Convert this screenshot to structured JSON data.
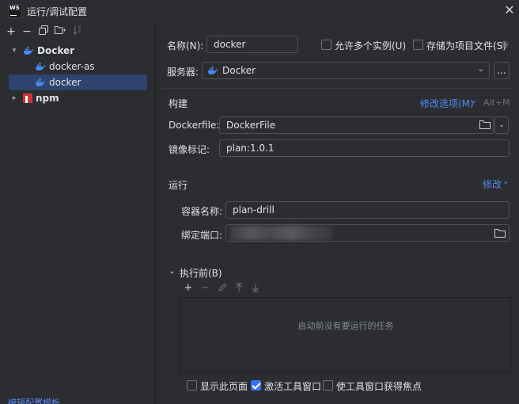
{
  "window": {
    "logo_text": "WS",
    "title": "运行/调试配置",
    "close_glyph": "✕"
  },
  "toolbar": {
    "add_glyph": "+",
    "remove_glyph": "−",
    "copy_icon": "copy-icon",
    "new_folder_icon": "new-folder-icon",
    "sort_icon": "sort-icon"
  },
  "tree": {
    "group_docker": "Docker",
    "item_docker_as": "docker-as",
    "item_docker": "docker",
    "group_npm": "npm",
    "expanded_glyph": "⌄",
    "collapsed_glyph": "›"
  },
  "edit_templates": "编辑配置模板...",
  "form": {
    "name_label": "名称(N):",
    "name_value": "docker",
    "allow_multiple": "允许多个实例(U)",
    "store_as_file": "存储为项目文件(S)",
    "server_label": "服务器:",
    "server_value": "Docker",
    "more_btn": "...",
    "build_title": "构建",
    "modify_options": "修改选项(M)",
    "modify_shortcut": "Alt+M",
    "dockerfile_label": "Dockerfile:",
    "dockerfile_value": "DockerFile",
    "image_tag_label": "镜像标记:",
    "image_tag_value": "plan:1.0.1",
    "run_title": "运行",
    "modify_link": "修改",
    "container_name_label": "容器名称:",
    "container_name_value": "plan-drill",
    "bind_ports_label": "绑定端口:",
    "before_launch_title": "执行前(B)",
    "before_launch_empty": "启动前没有要运行的任务",
    "show_page": "显示此页面",
    "activate_tool_window": "激活工具窗口",
    "focus_tool_window": "使工具窗口获得焦点"
  },
  "colors": {
    "background": "#2b2d30",
    "accent": "#3574f0",
    "link": "#548af7",
    "selection": "#2e436e",
    "docker_blue": "#4a8af4",
    "npm_red": "#c33"
  },
  "checkboxes": {
    "allow_multiple": false,
    "store_as_file": false,
    "show_page": false,
    "activate_tool_window": true,
    "focus_tool_window": false
  }
}
